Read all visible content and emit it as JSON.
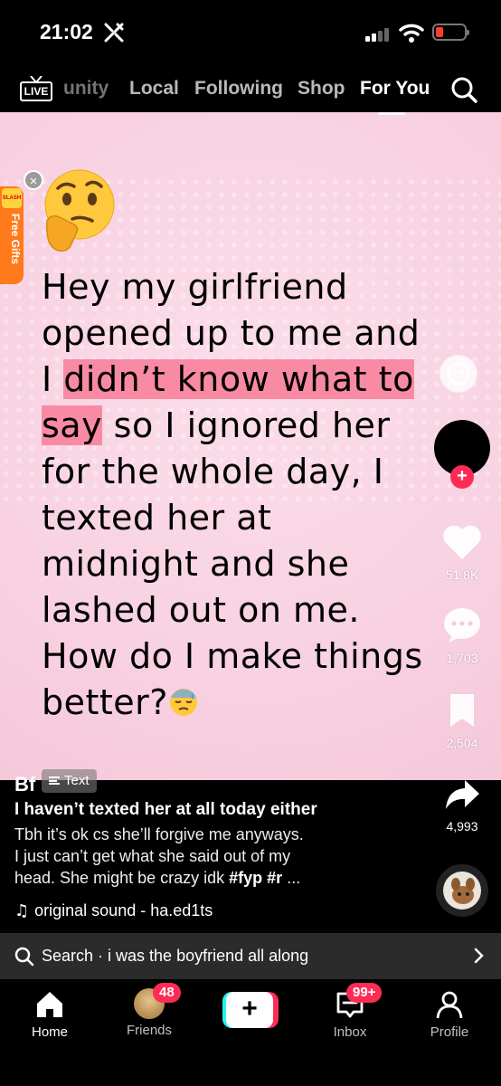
{
  "status_bar": {
    "time": "21:02",
    "battery_color": "#ff3b30"
  },
  "top_nav": {
    "live_label": "LIVE",
    "tabs": [
      "unity",
      "Local",
      "Following",
      "Shop",
      "For You"
    ],
    "active_tab": "For You"
  },
  "video": {
    "background_color": "#f8d2e2",
    "caption_parts": [
      {
        "text": "Hey my girlfriend opened up to me and I ",
        "highlight": false
      },
      {
        "text": "didn’t know what to say",
        "highlight": true
      },
      {
        "text": " so I ignored her for the whole day, I texted her at midnight and she lashed out on me. How do I make things better?",
        "highlight": false
      }
    ],
    "highlight_color": "#f98aa4",
    "emoji_top": "thinking-face",
    "emoji_end": "downcast-face-with-sweat"
  },
  "gift_widget": {
    "label": "Free Gifts",
    "close_label": "×"
  },
  "rail": {
    "likes": "51.8K",
    "comments": "1,703",
    "saves": "2,504",
    "shares": "4,993",
    "follow_label": "+"
  },
  "post": {
    "username": "Bf",
    "badge_label": "Text",
    "title": "I haven’t texted her at all today either",
    "description_line1": "Tbh it’s ok cs she’ll forgive me anyways.",
    "description_line2": "I just can’t get what she said out of my",
    "description_line3_text": "head. She might be crazy idk ",
    "hashtag_fyp": "#fyp",
    "hashtag_r": "#r",
    "ellipsis": " ...",
    "sound": "original sound - ha.ed1ts"
  },
  "search_bar": {
    "text": "Search · i was the boyfriend all along"
  },
  "tabbar": {
    "home": "Home",
    "friends": "Friends",
    "friends_badge": "48",
    "create_label": "+",
    "inbox": "Inbox",
    "inbox_badge": "99+",
    "profile": "Profile"
  }
}
